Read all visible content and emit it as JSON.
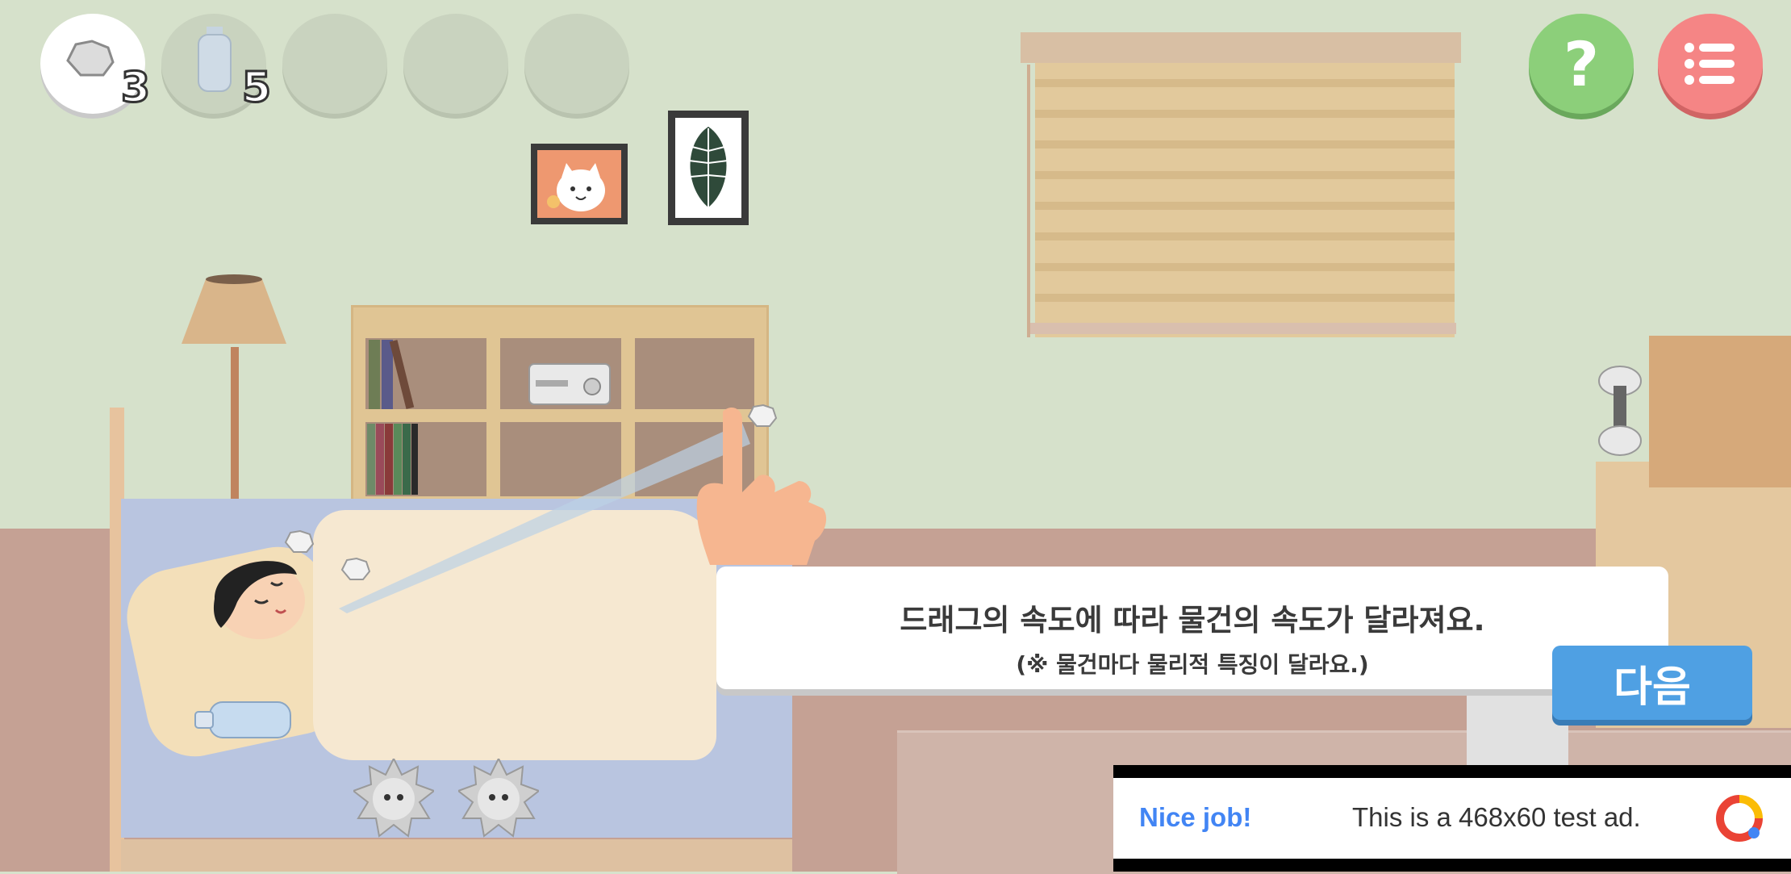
{
  "hud": {
    "slots": [
      {
        "icon": "crumpled-paper-icon",
        "count": "3",
        "active": true
      },
      {
        "icon": "water-bottle-icon",
        "count": "5",
        "active": false
      },
      {
        "icon": "",
        "count": "",
        "active": false
      },
      {
        "icon": "",
        "count": "",
        "active": false
      },
      {
        "icon": "",
        "count": "",
        "active": false
      }
    ],
    "help_label": "?",
    "menu_icon": "list-menu-icon"
  },
  "tutorial": {
    "line1": "드래그의 속도에 따라 물건의 속도가 달라져요.",
    "line2": "(※ 물건마다 물리적 특징이 달라요.)",
    "next_label": "다음"
  },
  "ad": {
    "headline": "Nice job!",
    "body": "This is a 468x60 test ad."
  },
  "colors": {
    "wall": "#d6e1cb",
    "floor": "#c5a194",
    "help_button": "#8ccf7a",
    "menu_button": "#f58585",
    "next_button": "#4fa0e3",
    "ad_headline": "#4285f4"
  }
}
